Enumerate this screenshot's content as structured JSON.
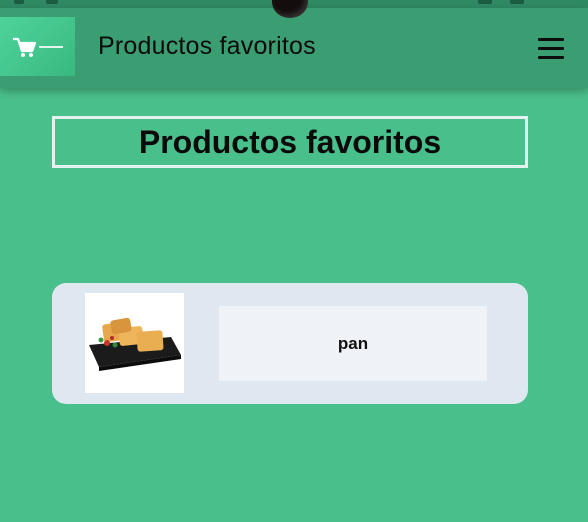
{
  "app_bar": {
    "title": "Productos favoritos",
    "logo_icon": "shopping-cart-icon",
    "menu_icon": "hamburger-menu-icon"
  },
  "main": {
    "heading": "Productos favoritos",
    "favorites": [
      {
        "name": "pan",
        "image_icon": "bread-pastries-image"
      }
    ]
  },
  "colors": {
    "background": "#49bf8b",
    "app_bar": "#3b9d72",
    "card": "#dfe7f0"
  }
}
